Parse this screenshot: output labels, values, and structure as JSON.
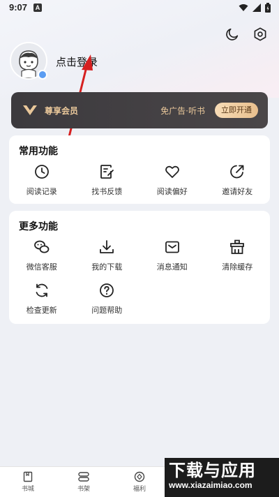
{
  "status_bar": {
    "time": "9:07",
    "notification_letter": "A"
  },
  "header": {
    "dark_mode_icon": "moon-icon",
    "settings_icon": "gear-icon"
  },
  "profile": {
    "login_label": "点击登录"
  },
  "vip": {
    "title": "尊享会员",
    "desc": "免广告·听书",
    "button": "立即开通"
  },
  "common": {
    "title": "常用功能",
    "items": [
      {
        "label": "阅读记录",
        "icon": "clock-icon"
      },
      {
        "label": "找书反馈",
        "icon": "feedback-icon"
      },
      {
        "label": "阅读偏好",
        "icon": "heart-icon"
      },
      {
        "label": "邀请好友",
        "icon": "invite-icon"
      }
    ]
  },
  "more": {
    "title": "更多功能",
    "items": [
      {
        "label": "微信客服",
        "icon": "wechat-icon"
      },
      {
        "label": "我的下载",
        "icon": "download-icon"
      },
      {
        "label": "消息通知",
        "icon": "mail-icon"
      },
      {
        "label": "清除缓存",
        "icon": "broom-icon"
      },
      {
        "label": "检查更新",
        "icon": "refresh-icon"
      },
      {
        "label": "问题帮助",
        "icon": "help-icon"
      }
    ]
  },
  "tabbar": [
    {
      "label": "书城",
      "icon": "book-icon"
    },
    {
      "label": "书架",
      "icon": "shelf-icon"
    },
    {
      "label": "福利",
      "icon": "welfare-icon"
    }
  ],
  "watermark": {
    "title": "下载与应用",
    "url": "www.xiazaimiao.com"
  },
  "colors": {
    "vip_bg": "#3c3a3e",
    "vip_gold": "#e9c79a",
    "accent_blue": "#5b9df2"
  }
}
